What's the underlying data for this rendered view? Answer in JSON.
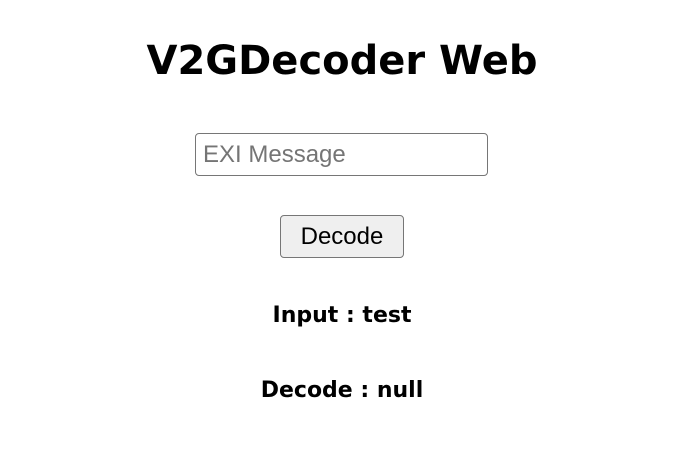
{
  "header": {
    "title": "V2GDecoder Web"
  },
  "form": {
    "exi_placeholder": "EXI Message",
    "exi_value": "",
    "decode_label": "Decode"
  },
  "results": {
    "input_label": "Input",
    "input_separator": " : ",
    "input_value": "test",
    "decode_label": "Decode",
    "decode_separator": " : ",
    "decode_value": "null"
  }
}
